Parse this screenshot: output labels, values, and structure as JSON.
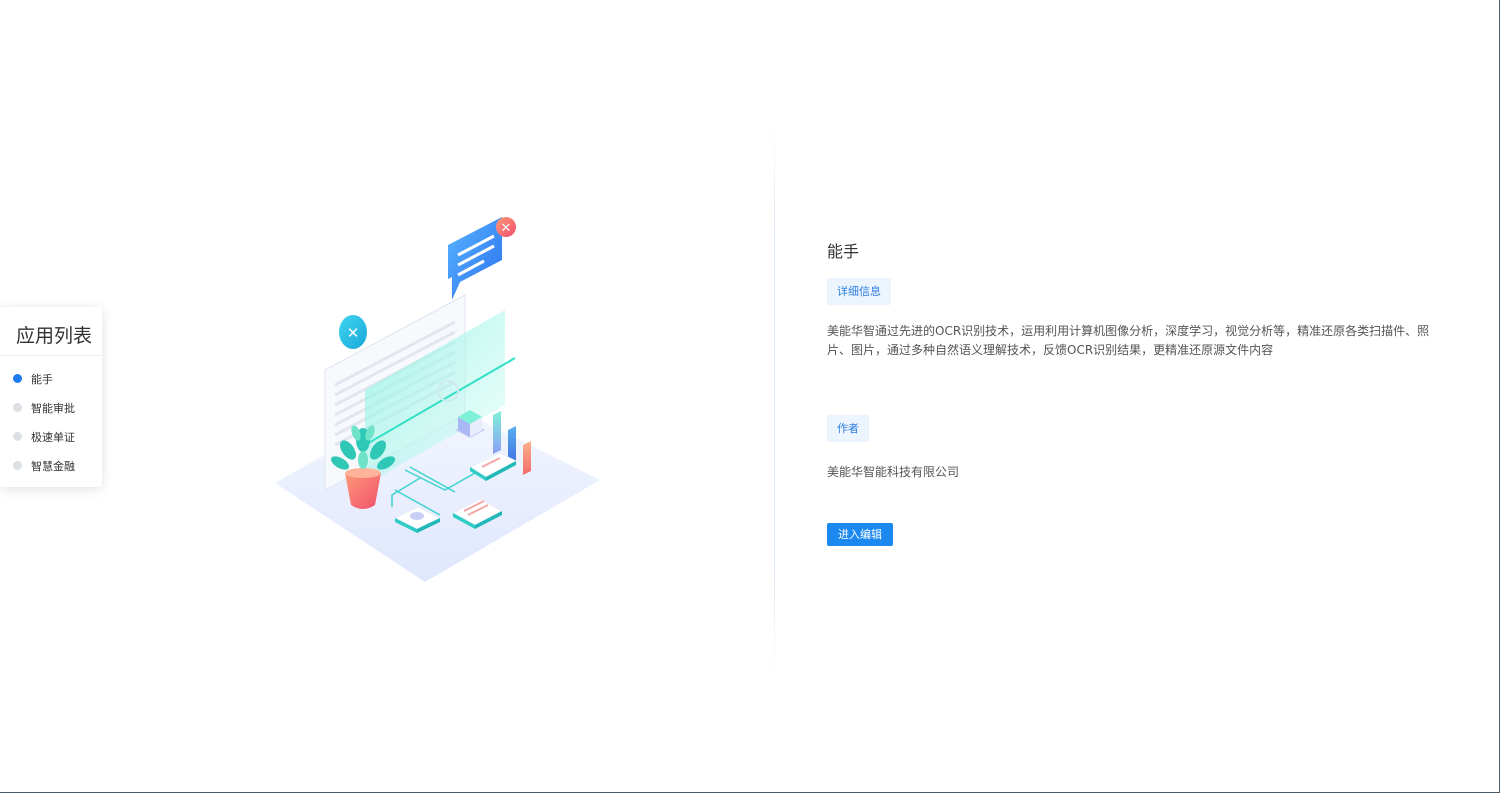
{
  "app_list": {
    "title": "应用列表",
    "items": [
      {
        "label": "能手",
        "active": true
      },
      {
        "label": "智能审批",
        "active": false
      },
      {
        "label": "极速单证",
        "active": false
      },
      {
        "label": "智慧金融",
        "active": false
      }
    ]
  },
  "detail": {
    "title": "能手",
    "info_tag": "详细信息",
    "description": "美能华智通过先进的OCR识别技术，运用利用计算机图像分析，深度学习，视觉分析等，精准还原各类扫描件、照片、图片，通过多种自然语义理解技术，反馈OCR识别结果，更精准还原源文件内容",
    "author_tag": "作者",
    "author": "美能华智能科技有限公司",
    "enter_button": "进入编辑"
  },
  "colors": {
    "accent": "#1c7cf0",
    "button": "#1c89f0",
    "tag_bg": "#ecf4fe",
    "tag_text": "#2f7fe0"
  }
}
